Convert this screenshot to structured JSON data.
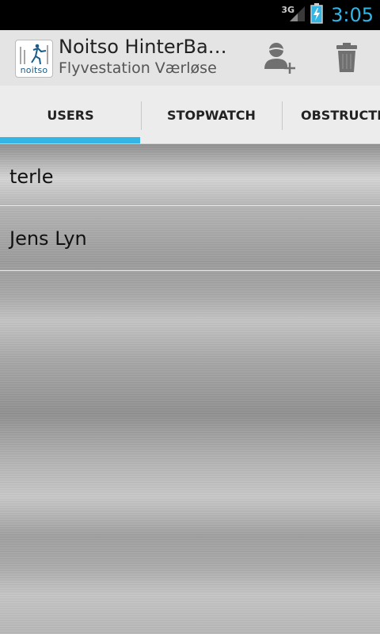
{
  "status_bar": {
    "network": "3G",
    "time": "3:05"
  },
  "action_bar": {
    "title": "Noitso HinterBa…",
    "subtitle": "Flyvestation Værløse",
    "logo_text": "noitso",
    "actions": [
      "add-user-icon",
      "trash-icon"
    ]
  },
  "tabs": [
    {
      "label": "USERS",
      "selected": true
    },
    {
      "label": "STOPWATCH",
      "selected": false
    },
    {
      "label": "OBSTRUCTIO",
      "selected": false
    }
  ],
  "users": [
    {
      "name": "terle"
    },
    {
      "name": "Jens Lyn"
    }
  ],
  "colors": {
    "accent": "#33b5e5",
    "action_bar_bg": "#e4e4e4",
    "icon_gray": "#707070"
  }
}
